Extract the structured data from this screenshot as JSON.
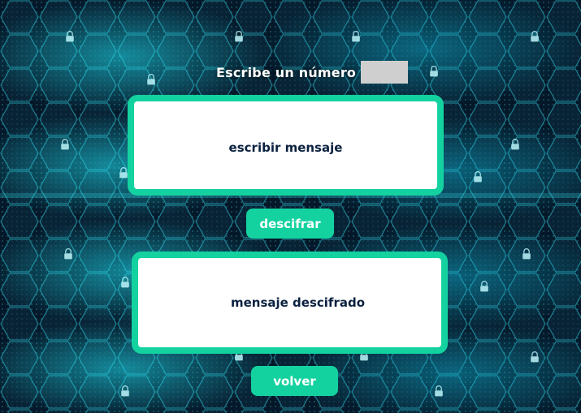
{
  "form": {
    "number_label": "Escribe un número",
    "number_value": ""
  },
  "input_box": {
    "placeholder": "escribir mensaje"
  },
  "decrypt_button": {
    "label": "descifrar"
  },
  "output_box": {
    "text": "mensaje descifrado"
  },
  "back_button": {
    "label": "volver"
  },
  "background": {
    "icon": "padlock-icon",
    "description_colors": {
      "base": "#041829",
      "glow": "#19d2e6"
    }
  },
  "colors": {
    "accent": "#14d2a0",
    "text_dark": "#0b2140",
    "input_gray": "#cfcfcf",
    "white": "#ffffff"
  }
}
